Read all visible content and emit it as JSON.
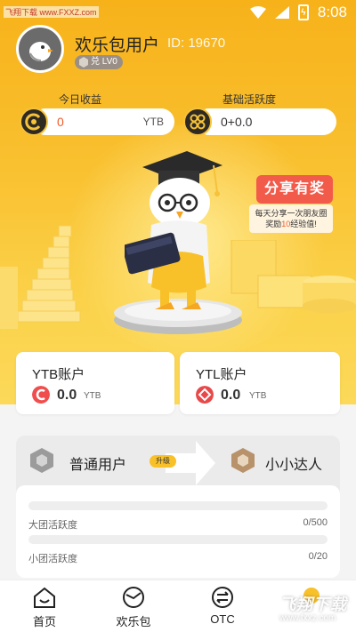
{
  "status_bar": {
    "time": "8:08",
    "watermark": "飞翔下载 www.FXXZ.com",
    "battery_icon": "battery-charging-icon"
  },
  "profile": {
    "username": "欢乐包用户",
    "user_id": "ID: 19670",
    "level": "兑 LV0"
  },
  "income": {
    "today_label": "今日收益",
    "today_value": "0",
    "today_unit": "YTB",
    "activity_label": "基础活跃度",
    "activity_value": "0+0.0"
  },
  "share": {
    "title": "分享有奖",
    "note_prefix": "每天分享一次朋友圈奖励",
    "note_number": "10",
    "note_suffix": "经验值!"
  },
  "accounts": [
    {
      "title": "YTB账户",
      "value": "0.0",
      "unit": "YTB",
      "color": "#f04e4e"
    },
    {
      "title": "YTL账户",
      "value": "0.0",
      "unit": "YTB",
      "color": "#e94848"
    }
  ],
  "levels": {
    "current": "普通用户",
    "upgrade_tag": "升级",
    "next": "小小达人",
    "progress": [
      {
        "label": "大团活跃度",
        "value": "0/500",
        "fraction": 0.0
      },
      {
        "label": "小团活跃度",
        "value": "0/20",
        "fraction": 0.0
      }
    ]
  },
  "tabbar": {
    "items": [
      {
        "label": "首页",
        "icon": "home-icon"
      },
      {
        "label": "欢乐包",
        "icon": "happy-bag-icon"
      },
      {
        "label": "OTC",
        "icon": "exchange-icon"
      },
      {
        "label": "",
        "icon": "profile-icon"
      }
    ]
  },
  "watermark": {
    "main": "飞翔下载",
    "sub": "www.fxxz.com"
  },
  "colors": {
    "brand_yellow": "#f9c02f",
    "accent_red": "#f25a4a",
    "income_red": "#f05a28"
  }
}
